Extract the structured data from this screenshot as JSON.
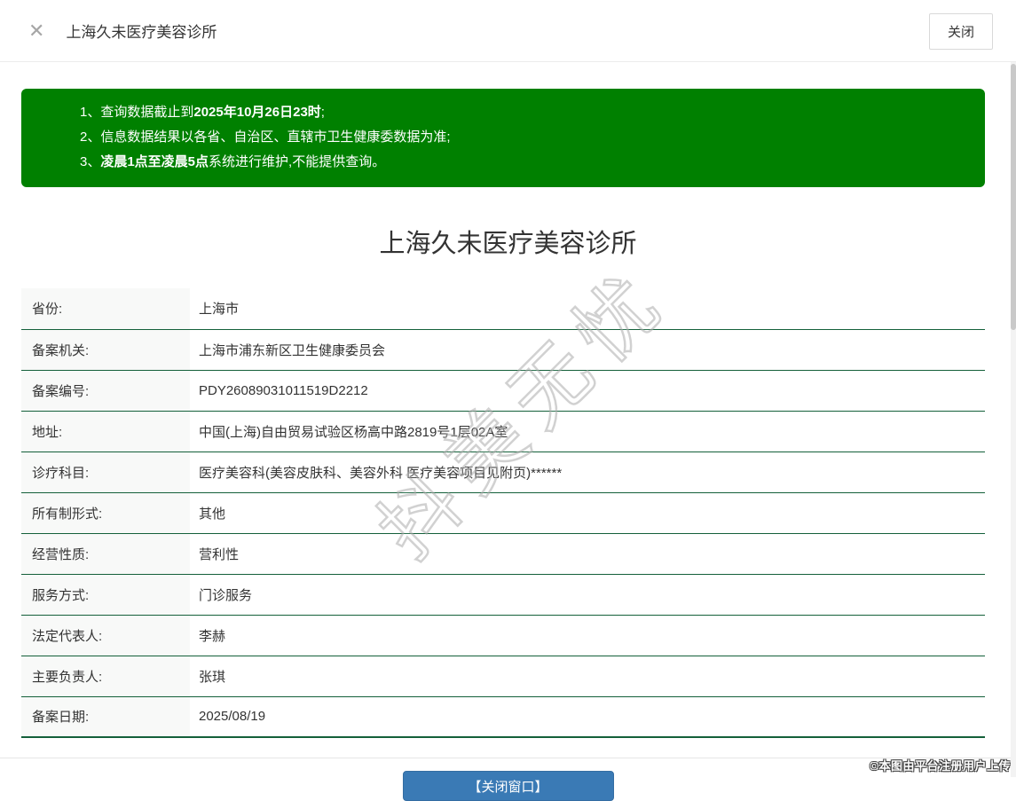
{
  "header": {
    "close_icon": "✕",
    "title": "上海久未医疗美容诊所",
    "close_button": "关闭"
  },
  "notice": {
    "items": [
      {
        "num": "1、",
        "pre": "查询数据截止到",
        "bold": "2025年10月26日23时",
        "post": ";"
      },
      {
        "num": "2、",
        "pre": "信息数据结果以各省、自治区、直辖市卫生健康委数据为准;",
        "bold": "",
        "post": ""
      },
      {
        "num": "3、",
        "pre": "",
        "bold": "凌晨1点至凌晨5点",
        "post": "系统进行维护,不能提供查询。"
      }
    ]
  },
  "main": {
    "title": "上海久未医疗美容诊所",
    "rows": [
      {
        "label": "省份:",
        "value": "上海市"
      },
      {
        "label": "备案机关:",
        "value": "上海市浦东新区卫生健康委员会"
      },
      {
        "label": "备案编号:",
        "value": "PDY26089031011519D2212"
      },
      {
        "label": "地址:",
        "value": "中国(上海)自由贸易试验区杨高中路2819号1层02A室"
      },
      {
        "label": "诊疗科目:",
        "value": "医疗美容科(美容皮肤科、美容外科 医疗美容项目见附页)******"
      },
      {
        "label": "所有制形式:",
        "value": "其他"
      },
      {
        "label": "经营性质:",
        "value": "营利性"
      },
      {
        "label": "服务方式:",
        "value": "门诊服务"
      },
      {
        "label": "法定代表人:",
        "value": "李赫"
      },
      {
        "label": "主要负责人:",
        "value": "张琪"
      },
      {
        "label": "备案日期:",
        "value": "2025/08/19"
      }
    ]
  },
  "footer": {
    "close_window_button": "【关闭窗口】"
  },
  "watermark": "抖美无忧",
  "credit": "©本图由平台注册用户上传",
  "colors": {
    "notice_bg": "#008000",
    "table_divider": "#14603a",
    "primary_button": "#3a7ab5"
  }
}
